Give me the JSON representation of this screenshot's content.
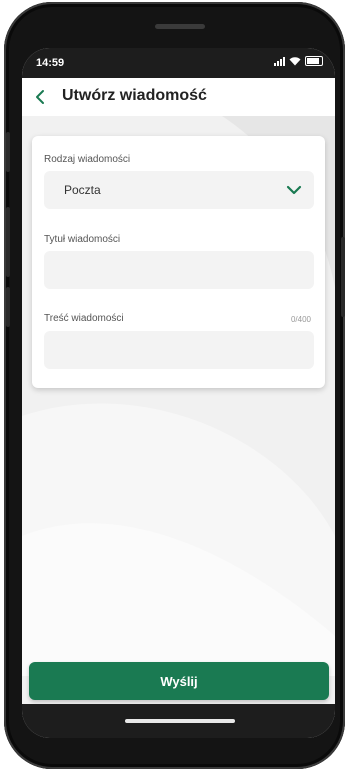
{
  "status_bar": {
    "time": "14:59"
  },
  "header": {
    "title": "Utwórz wiadomość"
  },
  "form": {
    "message_type": {
      "label": "Rodzaj wiadomości",
      "value": "Poczta"
    },
    "subject": {
      "label": "Tytuł wiadomości",
      "value": ""
    },
    "body": {
      "label": "Treść wiadomości",
      "value": "",
      "counter": "0/400"
    }
  },
  "actions": {
    "send_label": "Wyślij"
  },
  "colors": {
    "accent": "#1a7a52",
    "chevron": "#1a7a52"
  },
  "icons": [
    "back-chevron-icon",
    "signal-icon",
    "wifi-icon",
    "battery-icon",
    "chevron-down-icon"
  ]
}
